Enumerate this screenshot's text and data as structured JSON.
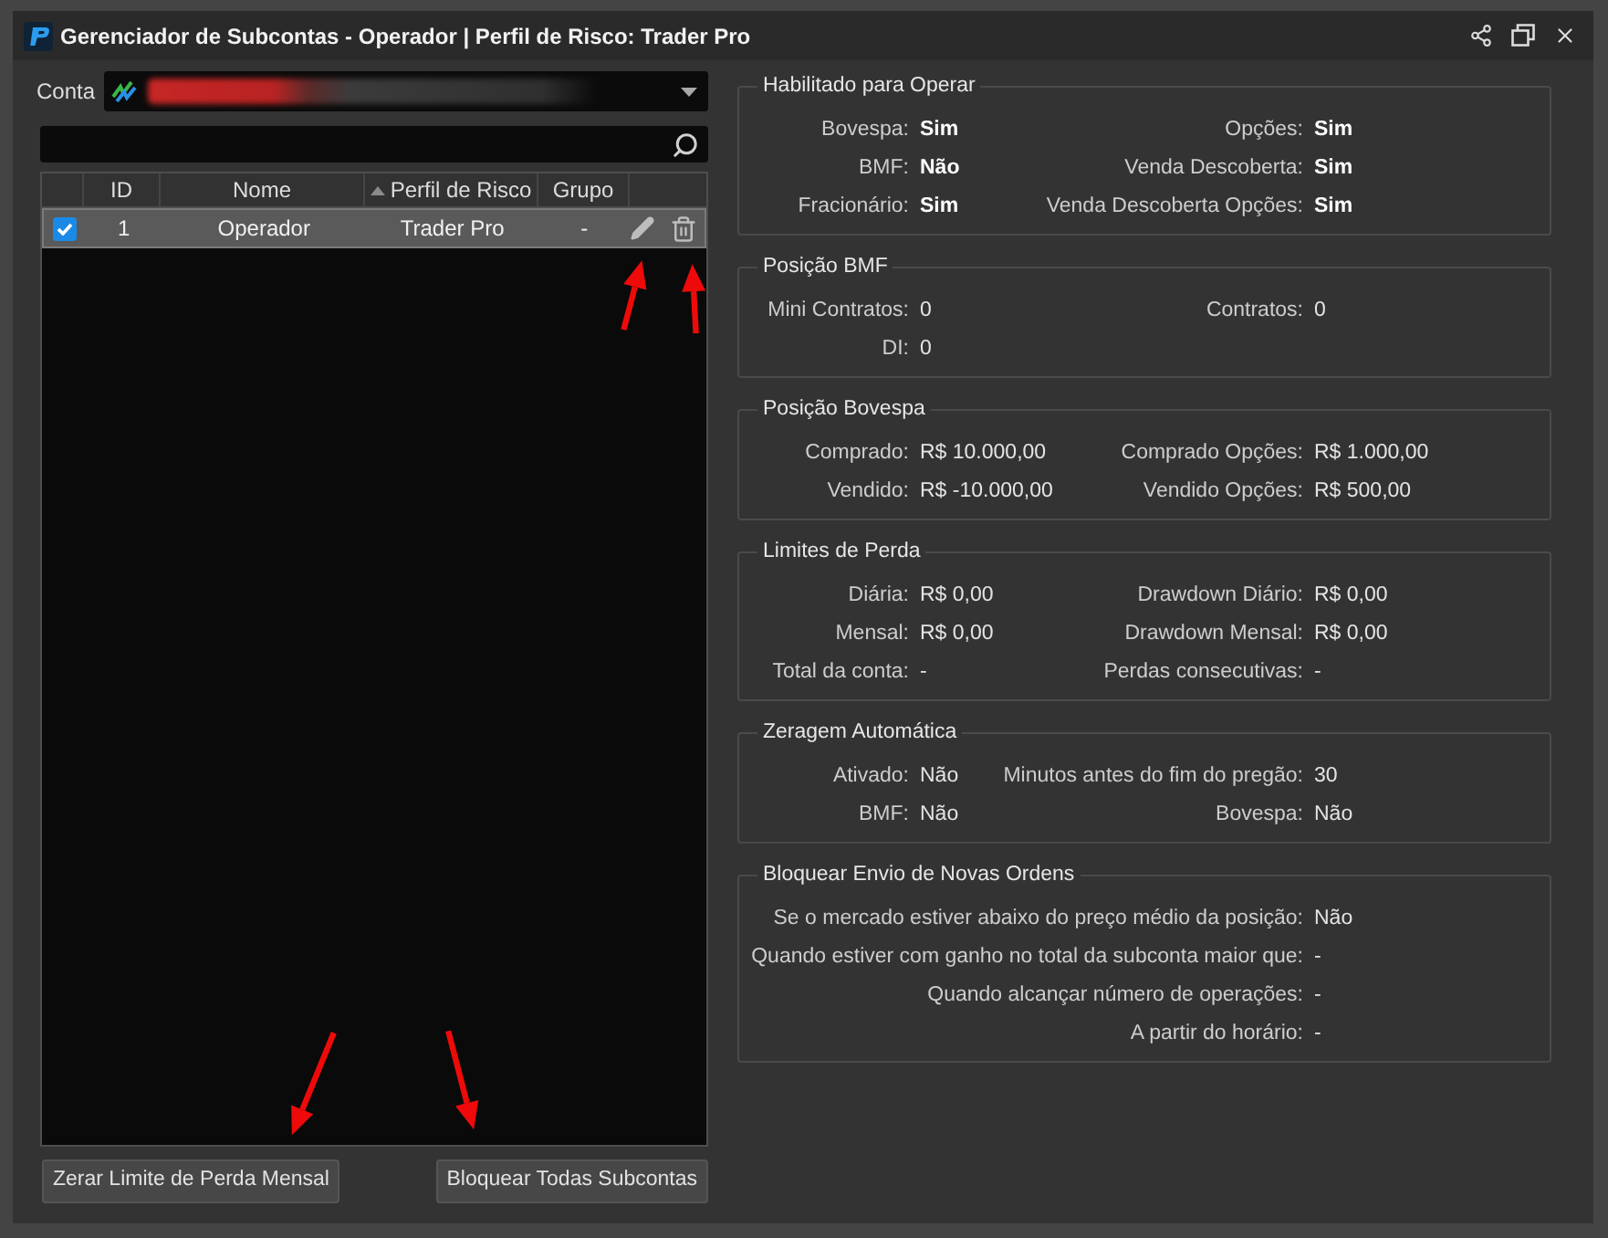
{
  "window": {
    "title": "Gerenciador de Subcontas - Operador | Perfil de Risco: Trader Pro"
  },
  "account": {
    "label": "Conta"
  },
  "table": {
    "columns": [
      {
        "label": "ID",
        "sorted": false
      },
      {
        "label": "Nome",
        "sorted": false
      },
      {
        "label": "Perfil de Risco",
        "sorted": true
      },
      {
        "label": "Grupo",
        "sorted": false
      }
    ],
    "rows": [
      {
        "selected": true,
        "checked": true,
        "cells": [
          "1",
          "Operador",
          "Trader Pro",
          "-"
        ]
      }
    ]
  },
  "buttons": [
    "Zerar Limite de Perda Mensal",
    "Bloquear Todas Subcontas"
  ],
  "groups": [
    {
      "title": "Habilitado para Operar",
      "kind": "flags",
      "rows": [
        [
          {
            "label": "Bovespa:",
            "value": "Sim"
          },
          {
            "label": "Opções:",
            "value": "Sim"
          }
        ],
        [
          {
            "label": "BMF:",
            "value": "Não"
          },
          {
            "label": "Venda Descoberta:",
            "value": "Sim"
          }
        ],
        [
          {
            "label": "Fracionário:",
            "value": "Sim"
          },
          {
            "label": "Venda Descoberta Opções:",
            "value": "Sim"
          }
        ]
      ]
    },
    {
      "title": "Posição BMF",
      "kind": "grid",
      "rows": [
        [
          {
            "label": "Mini Contratos:",
            "value": "0"
          },
          {
            "label": "Contratos:",
            "value": "0"
          }
        ],
        [
          {
            "label": "DI:",
            "value": "0"
          }
        ]
      ]
    },
    {
      "title": "Posição Bovespa",
      "kind": "grid",
      "rows": [
        [
          {
            "label": "Comprado:",
            "value": "R$ 10.000,00"
          },
          {
            "label": "Comprado Opções:",
            "value": "R$ 1.000,00"
          }
        ],
        [
          {
            "label": "Vendido:",
            "value": "R$ -10.000,00"
          },
          {
            "label": "Vendido Opções:",
            "value": "R$ 500,00"
          }
        ]
      ]
    },
    {
      "title": "Limites de Perda",
      "kind": "grid",
      "rows": [
        [
          {
            "label": "Diária:",
            "value": "R$ 0,00"
          },
          {
            "label": "Drawdown Diário:",
            "value": "R$ 0,00"
          }
        ],
        [
          {
            "label": "Mensal:",
            "value": "R$ 0,00"
          },
          {
            "label": "Drawdown Mensal:",
            "value": "R$ 0,00"
          }
        ],
        [
          {
            "label": "Total da conta:",
            "value": "-"
          },
          {
            "label": "Perdas consecutivas:",
            "value": "-"
          }
        ]
      ]
    },
    {
      "title": "Zeragem Automática",
      "kind": "grid",
      "rows": [
        [
          {
            "label": "Ativado:",
            "value": "Não"
          },
          {
            "label": "Minutos antes do fim do pregão:",
            "value": "30"
          }
        ],
        [
          {
            "label": "BMF:",
            "value": "Não"
          },
          {
            "label": "Bovespa:",
            "value": "Não"
          }
        ]
      ]
    },
    {
      "title": "Bloquear Envio de Novas Ordens",
      "kind": "list",
      "rows": [
        [
          {
            "label": "Se o mercado estiver abaixo do preço médio da posição:",
            "value": "Não"
          }
        ],
        [
          {
            "label": "Quando estiver com ganho no total da subconta maior que:",
            "value": "-"
          }
        ],
        [
          {
            "label": "Quando alcançar número de operações:",
            "value": "-"
          }
        ],
        [
          {
            "label": "A partir do horário:",
            "value": "-"
          }
        ]
      ]
    }
  ]
}
